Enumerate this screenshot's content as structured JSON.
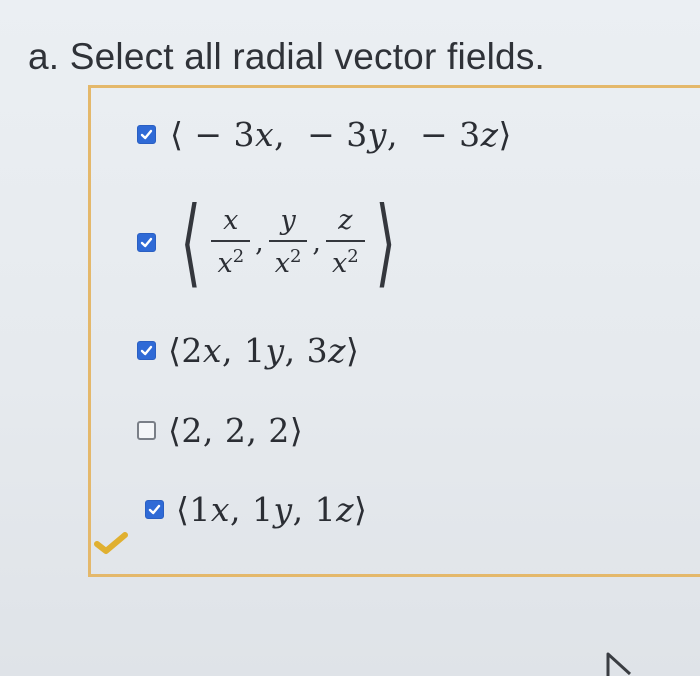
{
  "question": {
    "prompt": "a. Select all radial vector fields."
  },
  "options": [
    {
      "checked": true,
      "parts": [
        "⟨",
        "−",
        "3",
        "x",
        ",",
        "−",
        "3",
        "y",
        ",",
        "−",
        "3",
        "z",
        "⟩"
      ]
    },
    {
      "checked": true,
      "fractions": [
        {
          "num": "x",
          "den": "x",
          "exp": "2"
        },
        {
          "num": "y",
          "den": "x",
          "exp": "2"
        },
        {
          "num": "z",
          "den": "x",
          "exp": "2"
        }
      ],
      "open_bracket": "⟨",
      "close_bracket": "⟩",
      "separator": ","
    },
    {
      "checked": true,
      "parts": [
        "⟨",
        "2",
        "x",
        ",",
        "1",
        "y",
        ",",
        "3",
        "z",
        "⟩"
      ]
    },
    {
      "checked": false,
      "parts": [
        "⟨",
        "2",
        ",",
        "2",
        ",",
        "2",
        "⟩"
      ]
    },
    {
      "checked": true,
      "parts": [
        "⟨",
        "1",
        "x",
        ",",
        "1",
        "y",
        ",",
        "1",
        "z",
        "⟩"
      ]
    }
  ],
  "colors": {
    "checkbox_checked": "#2f6ad6",
    "box_border": "#e4b86b",
    "correct_mark": "#e0b030"
  },
  "icons": {
    "correct": "checkmark-icon",
    "cursor": "mouse-cursor-icon"
  }
}
